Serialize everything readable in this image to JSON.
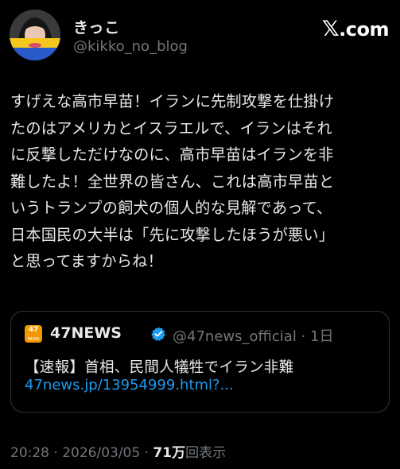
{
  "author": {
    "display_name": "きっこ",
    "handle": "@kikko_no_blog",
    "avatar_icon": "user-avatar"
  },
  "brand": {
    "site": ".com",
    "logo_icon": "x-logo-icon"
  },
  "tweet": {
    "lines": [
      "すげえな高市早苗！イランに先制攻撃を仕掛け",
      "たのはアメリカとイスラエルで、イランはそれ",
      "に反撃しただけなのに、高市早苗はイランを非",
      "難したよ！全世界の皆さん、これは高市早苗と",
      "いうトランプの飼犬の個人的な見解であって、",
      "日本国民の大半は「先に攻撃したほうが悪い」",
      "と思ってますからね！"
    ]
  },
  "quote": {
    "logo_text": "47",
    "logo_sub": "NEWS",
    "name": "47NEWS",
    "verified_icon": "verified-badge-icon",
    "handle_time": "@47news_official · 1日",
    "text": "【速報】首相、民間人犠牲でイラン非難",
    "link": "47news.jp/13954999.html?..."
  },
  "meta": {
    "timestamp": "20:28 · 2026/03/05 · ",
    "views_count": "71万",
    "views_label": "回表示"
  },
  "colors": {
    "background": "#000000",
    "text": "#e7e9ea",
    "secondary": "#71767b",
    "link": "#1d9bf0",
    "border": "#2f3336",
    "logo_orange": "#f39800"
  }
}
